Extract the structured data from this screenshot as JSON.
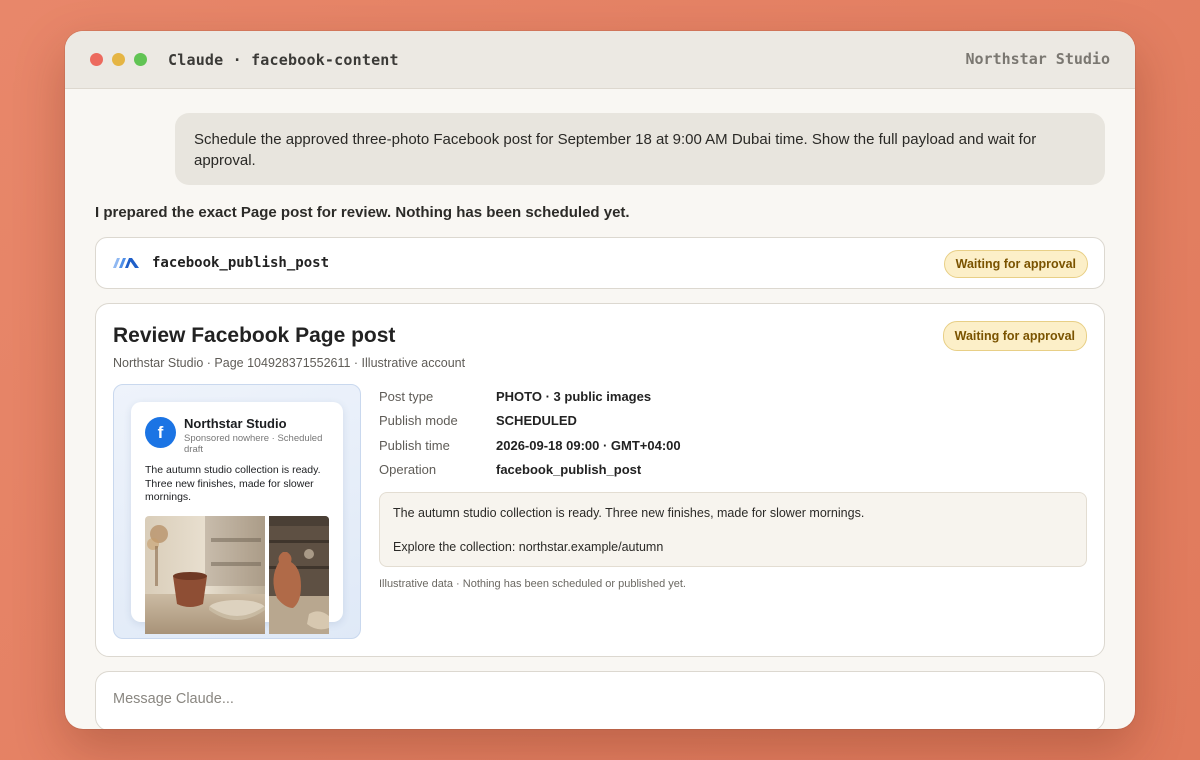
{
  "window": {
    "title": "Claude · facebook-content",
    "workspace": "Northstar Studio"
  },
  "chat": {
    "user_message": "Schedule the approved three-photo Facebook post for September 18 at 9:00 AM Dubai time. Show the full payload and wait for approval.",
    "assistant_message": "I prepared the exact Page post for review. Nothing has been scheduled yet."
  },
  "tool_call": {
    "icon": "connector-logo-icon",
    "name": "facebook_publish_post",
    "status": "Waiting for approval"
  },
  "review_card": {
    "title": "Review Facebook Page post",
    "status": "Waiting for approval",
    "subtitle": "Northstar Studio · Page 104928371552611 · Illustrative account",
    "preview": {
      "avatar_letter": "f",
      "page_name": "Northstar Studio",
      "meta": "Sponsored nowhere · Scheduled draft",
      "text": "The autumn studio collection is ready. Three new finishes, made for slower mornings."
    },
    "details": [
      {
        "label": "Post type",
        "value": "PHOTO · 3 public images"
      },
      {
        "label": "Publish mode",
        "value": "SCHEDULED"
      },
      {
        "label": "Publish time",
        "value": "2026-09-18 09:00 · GMT+04:00"
      },
      {
        "label": "Operation",
        "value": "facebook_publish_post"
      }
    ],
    "caption_line1": "The autumn studio collection is ready. Three new finishes, made for slower mornings.",
    "caption_line2": "Explore the collection: northstar.example/autumn",
    "note": "Illustrative data · Nothing has been scheduled or published yet."
  },
  "composer": {
    "placeholder": "Message Claude..."
  },
  "colors": {
    "background": "#e07a5c",
    "badge_bg": "#fcefc8",
    "badge_text": "#7a5300",
    "facebook_blue": "#1b74e4"
  }
}
